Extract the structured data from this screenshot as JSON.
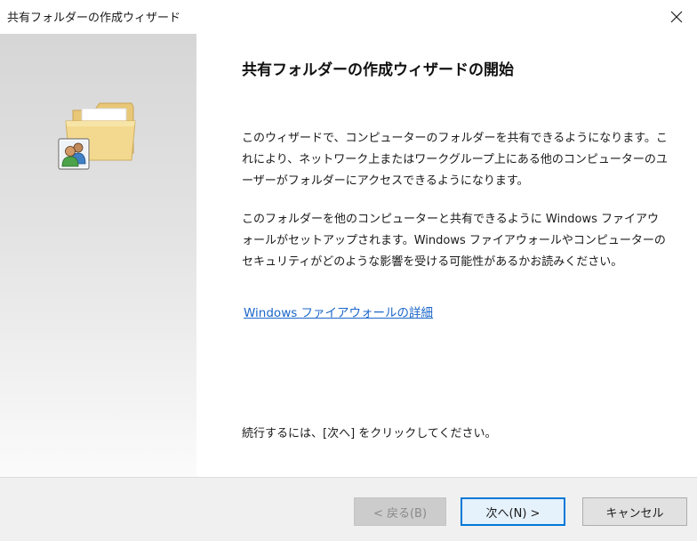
{
  "window": {
    "title": "共有フォルダーの作成ウィザード"
  },
  "icons": {
    "close": "close-icon",
    "wizard": "shared-folder-users-icon"
  },
  "main": {
    "heading": "共有フォルダーの作成ウィザードの開始",
    "paragraph1": "このウィザードで、コンピューターのフォルダーを共有できるようになります。これにより、ネットワーク上またはワークグループ上にある他のコンピューターのユーザーがフォルダーにアクセスできるようになります。",
    "paragraph2": "このフォルダーを他のコンピューターと共有できるように Windows ファイアウォールがセットアップされます。Windows ファイアウォールやコンピューターのセキュリティがどのような影響を受ける可能性があるかお読みください。",
    "help_link": "Windows ファイアウォールの詳細",
    "continue_text": "続行するには、[次へ] をクリックしてください。"
  },
  "footer": {
    "back_label": "< 戻る(B)",
    "next_label": "次へ(N) >",
    "cancel_label": "キャンセル"
  },
  "colors": {
    "link": "#1a66c9",
    "default_button_border": "#0078d7",
    "footer_background": "#f0f0f0"
  }
}
